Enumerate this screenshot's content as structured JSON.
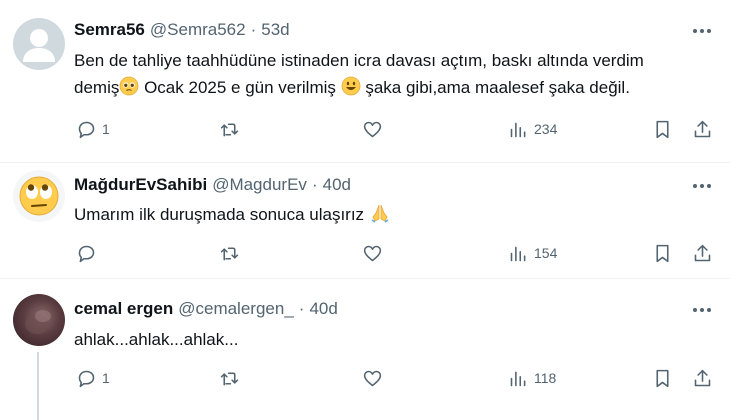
{
  "tweets": [
    {
      "name": "Semra56",
      "handle": "@Semra562",
      "dot": "·",
      "time": "53d",
      "text_lines": [
        "Ben de tahliye taahhüdüne istinaden icra davası açtım, baskı altında verdim",
        "demiş",
        " Ocak 2025 e gün verilmiş ",
        " şaka gibi,ama maalesef şaka değil."
      ],
      "reply_count": "1",
      "retweet_count": "",
      "like_count": "",
      "views_count": "234",
      "avatar": "default-profile"
    },
    {
      "name": "MağdurEvSahibi",
      "handle": "@MagdurEv",
      "dot": "·",
      "time": "40d",
      "text": "Umarım ilk duruşmada sonuca ulaşırız ",
      "reply_count": "",
      "retweet_count": "",
      "like_count": "",
      "views_count": "154",
      "avatar": "rolling-eyes-emoji"
    },
    {
      "name": "cemal ergen",
      "handle": "@cemalergen_",
      "dot": "·",
      "time": "40d",
      "text": "ahlak...ahlak...ahlak...",
      "reply_count": "1",
      "retweet_count": "",
      "like_count": "",
      "views_count": "118",
      "avatar": "profile-photo"
    }
  ],
  "icons": {
    "reply": "reply-icon",
    "retweet": "retweet-icon",
    "like": "heart-icon",
    "views": "views-icon",
    "bookmark": "bookmark-icon",
    "share": "share-icon",
    "more": "more-icon"
  },
  "colors": {
    "text_primary": "#0f1419",
    "text_secondary": "#536471",
    "divider": "#eff3f4",
    "thread_line": "#cfd9de"
  }
}
